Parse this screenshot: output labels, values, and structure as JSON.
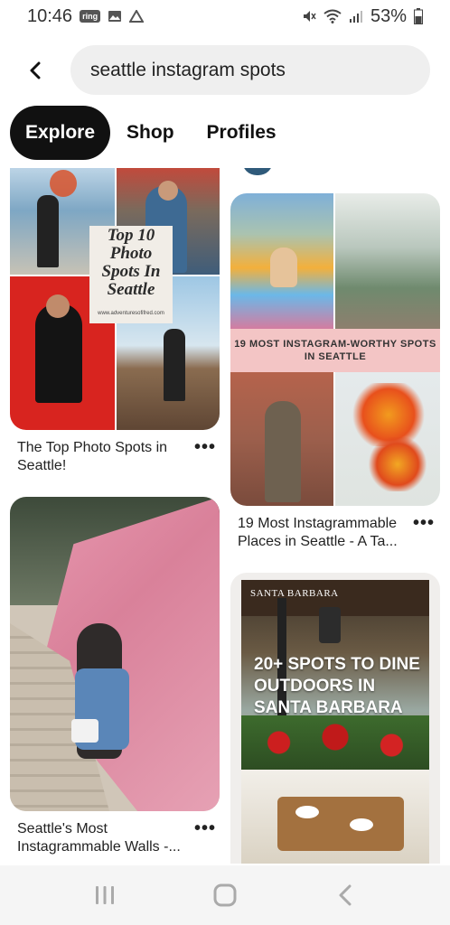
{
  "status": {
    "time": "10:46",
    "battery": "53%",
    "icons": [
      "ring-icon",
      "gallery-icon",
      "drive-icon",
      "mute-icon",
      "wifi-icon",
      "signal-icon",
      "battery-icon"
    ]
  },
  "search": {
    "query": "seattle instagram spots"
  },
  "tabs": [
    {
      "label": "Explore",
      "active": true
    },
    {
      "label": "Shop",
      "active": false
    },
    {
      "label": "Profiles",
      "active": false
    }
  ],
  "pins": [
    {
      "title": "The Top Photo Spots in Seattle!",
      "overlay": "Top 10 Photo Spots In Seattle",
      "overlay_url": "www.adventuresofifred.com"
    },
    {
      "title": "19 Most Instagrammable Places in Seattle - A Ta...",
      "overlay": "19 MOST INSTAGRAM-WORTHY SPOTS IN SEATTLE"
    },
    {
      "title": "Seattle's Most Instagrammable Walls -..."
    },
    {
      "brand": "SANTA BARBARA",
      "overlay": "20+ SPOTS TO DINE OUTDOORS IN SANTA BARBARA"
    }
  ],
  "more_label": "•••",
  "nav": [
    "recents-icon",
    "home-icon",
    "back-icon"
  ],
  "colors": {
    "accent": "#111111",
    "search_bg": "#efefef",
    "pink_band": "#f3c5c5"
  }
}
